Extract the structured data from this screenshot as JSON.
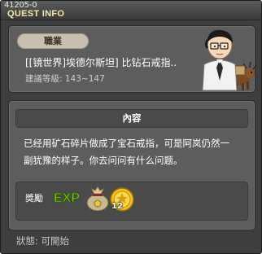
{
  "window": {
    "quest_id": "41205-0",
    "title": "QUEST INFO"
  },
  "quest": {
    "job_label": "職業",
    "name": "[[镜世界]埃德尔斯坦] 比钻石戒指..",
    "level_requirement": "建議等級: 143~147"
  },
  "content": {
    "header": "內容",
    "description_line1": "已经用矿石碎片做成了宝石戒指，可是阿岚仍然一",
    "description_line2": "副犹豫的样子。你去问问有什么问题。"
  },
  "rewards": {
    "label": "獎勵",
    "items": [
      {
        "icon": "exp-icon",
        "text": "EXP"
      },
      {
        "icon": "meso-bag-icon"
      },
      {
        "icon": "gold-coin-icon",
        "count": "12"
      }
    ]
  },
  "status": {
    "text": "狀態:  可開始"
  },
  "colors": {
    "window_bg": "#3e3e3e",
    "panel_bg": "#5d5d5d",
    "title": "#f4e9a8",
    "pill_bg": "#c9bfae",
    "exp_green": "#7fd01a"
  }
}
